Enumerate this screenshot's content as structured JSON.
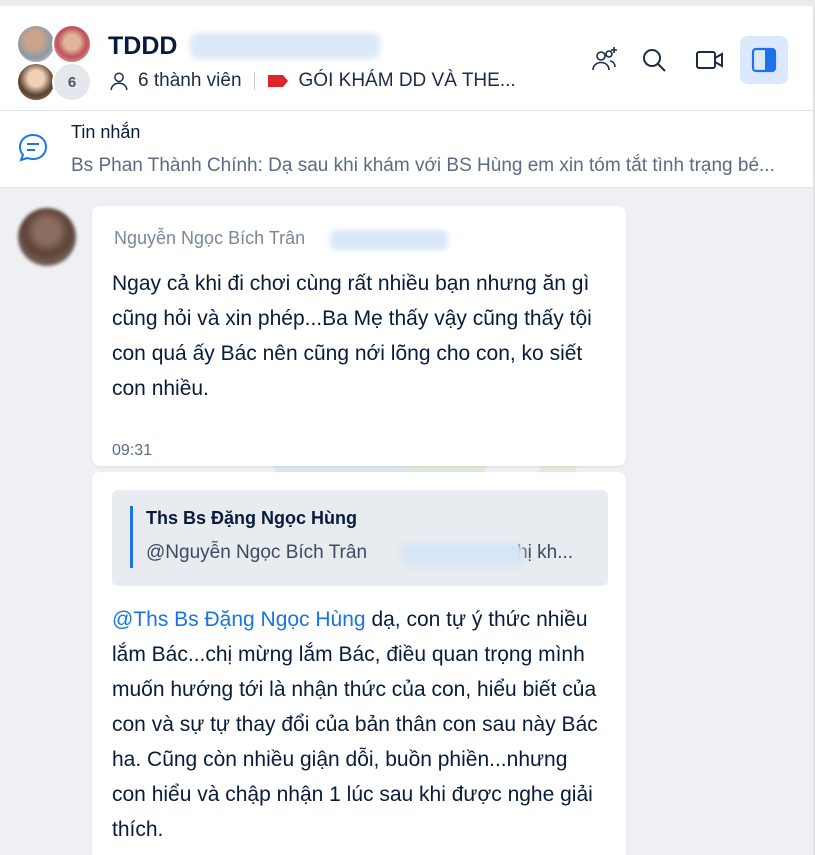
{
  "header": {
    "title": "TDDD",
    "member_count_badge": "6",
    "members_label": "6 thành viên",
    "tag_label": "GÓI KHÁM DD VÀ THE...",
    "icons": [
      "add-member-icon",
      "search-icon",
      "video-call-icon",
      "side-panel-icon"
    ]
  },
  "pinned": {
    "title": "Tin nhắn",
    "text": "Bs Phan Thành Chính: Dạ sau khi khám với BS Hùng em xin tóm tắt tình trạng bé..."
  },
  "messages": [
    {
      "sender": "Nguyễn Ngọc Bích Trân",
      "text": "Ngay cả khi đi chơi cùng rất nhiều bạn nhưng ăn gì cũng hỏi và xin phép...Ba Mẹ thấy vậy cũng thấy tội con quá ấy Bác nên cũng nới lõng cho con, ko siết con nhiều.",
      "time": "09:31"
    },
    {
      "quote": {
        "name": "Ths Bs Đặng Ngọc Hùng",
        "text": "@Nguyễn Ngọc Bích Trân",
        "text_tail": "chị kh..."
      },
      "mention": "@Ths Bs Đặng Ngọc Hùng",
      "text": " dạ, con tự ý thức nhiều lắm Bác...chị mừng lắm Bác, điều quan trọng mình muốn hướng tới là nhận thức của con, hiểu biết của con và sự tự thay đổi của bản thân con sau này Bác ha. Cũng còn nhiều giận dỗi, buồn phiền...nhưng con hiểu và chập nhận 1 lúc sau khi được nghe giải thích."
    }
  ],
  "colors": {
    "accent": "#1a73e8",
    "tag_red": "#e0242b",
    "background": "#eef0f3"
  }
}
